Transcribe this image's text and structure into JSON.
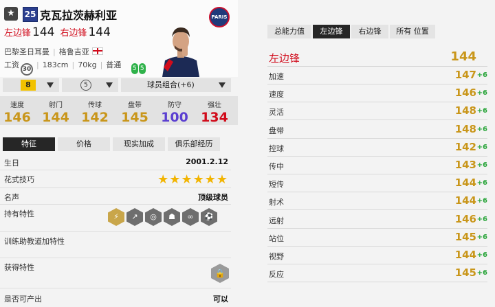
{
  "player": {
    "badge_icon": "star-icon",
    "season": "25",
    "name": "克瓦拉茨赫利亚",
    "club_logo_text": "PARIS",
    "positions": [
      {
        "pos": "左边锋",
        "val": "144"
      },
      {
        "pos": "右边锋",
        "val": "144"
      }
    ],
    "club": "巴黎圣日耳曼",
    "nation": "格鲁吉亚",
    "pay_label": "工资",
    "pay": "30",
    "height": "183cm",
    "weight": "70kg",
    "body": "普通",
    "left_foot": "5",
    "right_foot": "5"
  },
  "selectors": {
    "level": "8",
    "skill_level": "5",
    "team_color": "球员组合(+6)"
  },
  "main_stats": [
    {
      "label": "速度",
      "value": "146",
      "color": "#c9961a"
    },
    {
      "label": "射门",
      "value": "144",
      "color": "#c9961a"
    },
    {
      "label": "传球",
      "value": "142",
      "color": "#c9961a"
    },
    {
      "label": "盘带",
      "value": "145",
      "color": "#c9961a"
    },
    {
      "label": "防守",
      "value": "100",
      "color": "#5b3fd1"
    },
    {
      "label": "强壮",
      "value": "134",
      "color": "#d10b1b"
    }
  ],
  "tabs": [
    "特征",
    "价格",
    "现实加成",
    "俱乐部经历"
  ],
  "details": {
    "birthday_label": "生日",
    "birthday": "2001.2.12",
    "skill_label": "花式技巧",
    "skill_stars": "★★★★★★",
    "fame_label": "名声",
    "fame": "顶级球员",
    "traits_label": "持有特性",
    "coach_traits_label": "训练助教道加特性",
    "acquired_label": "获得特性",
    "tradable_label": "是否可产出",
    "tradable": "可以"
  },
  "right_tabs": [
    "总能力值",
    "左边锋",
    "右边锋",
    "所有 位置"
  ],
  "position_summary": {
    "label": "左边锋",
    "value": "144"
  },
  "attributes": [
    {
      "name": "加速",
      "value": "147",
      "bonus": "+6"
    },
    {
      "name": "速度",
      "value": "146",
      "bonus": "+6"
    },
    {
      "name": "灵活",
      "value": "148",
      "bonus": "+6"
    },
    {
      "name": "盘带",
      "value": "148",
      "bonus": "+6"
    },
    {
      "name": "控球",
      "value": "142",
      "bonus": "+6"
    },
    {
      "name": "传中",
      "value": "143",
      "bonus": "+6"
    },
    {
      "name": "短传",
      "value": "144",
      "bonus": "+6"
    },
    {
      "name": "射术",
      "value": "144",
      "bonus": "+6"
    },
    {
      "name": "远射",
      "value": "146",
      "bonus": "+6"
    },
    {
      "name": "站位",
      "value": "145",
      "bonus": "+6"
    },
    {
      "name": "视野",
      "value": "144",
      "bonus": "+6"
    },
    {
      "name": "反应",
      "value": "145",
      "bonus": "+6"
    }
  ]
}
